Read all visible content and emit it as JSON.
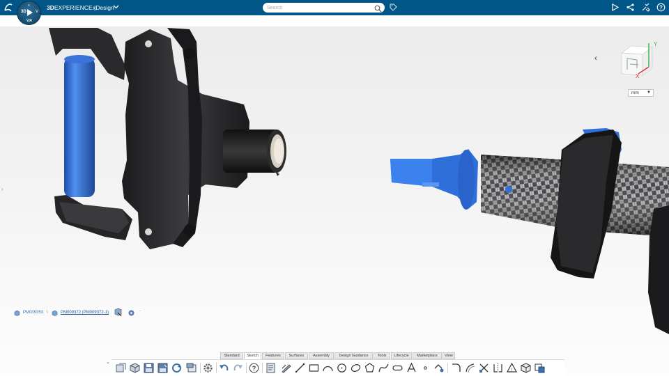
{
  "topbar": {
    "brand_bold": "3D",
    "brand_rest": "EXPERIENCE |",
    "app_name": "xDesign",
    "compass": {
      "top": "o",
      "left": "3D",
      "right": "V",
      "bottom": "V,R"
    },
    "search": {
      "placeholder": "Search",
      "value": ""
    },
    "right_icons": [
      "share-icon",
      "connect-icon",
      "tools-icon",
      "help-icon"
    ]
  },
  "viewport": {
    "units": {
      "value": "mm"
    },
    "axis": {
      "y": "Y",
      "x": "X"
    }
  },
  "breadcrumb": {
    "items": [
      {
        "label": "PM009353",
        "link": false
      },
      {
        "separator": "\\"
      },
      {
        "label": "PM009372 (PM009372-1)",
        "link": true
      }
    ]
  },
  "action_bar": {
    "tabs": [
      "Standard",
      "Sketch",
      "Features",
      "Surfaces",
      "Assembly",
      "Design Guidance",
      "Tools",
      "Lifecycle",
      "Marketplace",
      "View"
    ],
    "active_tab": "Sketch"
  },
  "colors": {
    "topbar": "#005686",
    "accent_blue": "#2f6fd9",
    "part_dark": "#2a2a2c"
  }
}
